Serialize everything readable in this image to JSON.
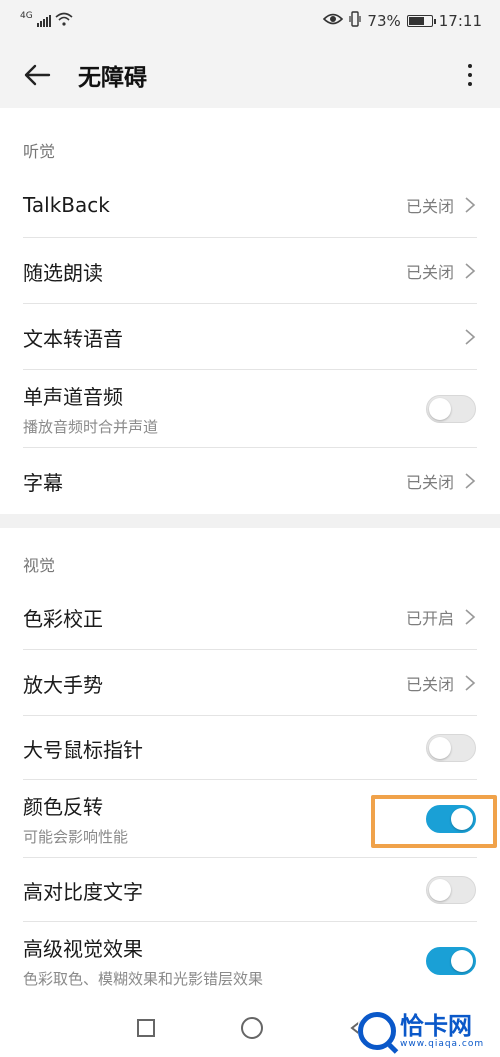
{
  "status_bar": {
    "network": "4G",
    "battery": "73%",
    "battery_level": 0.73,
    "time": "17:11",
    "icons": [
      "signal-icon",
      "wifi-icon",
      "eye-icon",
      "vibrate-icon",
      "battery-icon"
    ]
  },
  "header": {
    "back_icon": "back-arrow-icon",
    "title": "无障碍",
    "more_icon": "more-vertical-icon"
  },
  "sections": {
    "hearing": {
      "title": "听觉",
      "items": [
        {
          "label": "TalkBack",
          "value": "已关闭"
        },
        {
          "label": "随选朗读",
          "value": "已关闭"
        },
        {
          "label": "文本转语音"
        },
        {
          "label": "单声道音频",
          "sub": "播放音频时合并声道",
          "toggle": false
        },
        {
          "label": "字幕",
          "value": "已关闭"
        }
      ]
    },
    "vision": {
      "title": "视觉",
      "items": [
        {
          "label": "色彩校正",
          "value": "已开启"
        },
        {
          "label": "放大手势",
          "value": "已关闭"
        },
        {
          "label": "大号鼠标指针",
          "toggle": false
        },
        {
          "label": "颜色反转",
          "sub": "可能会影响性能",
          "toggle": true
        },
        {
          "label": "高对比度文字",
          "toggle": false
        },
        {
          "label": "高级视觉效果",
          "sub": "色彩取色、模糊效果和光影错层效果",
          "toggle": true
        }
      ]
    }
  },
  "nav_bar": {
    "icons": [
      "recent-apps-icon",
      "home-icon",
      "back-icon"
    ]
  },
  "watermark": {
    "main": "恰卡网",
    "url": "www.qiaqa.com"
  },
  "colors": {
    "accent": "#1aa0d6",
    "highlight": "#f0a24a",
    "header_bg": "#f3f3f3",
    "watermark": "#0a58c9"
  }
}
